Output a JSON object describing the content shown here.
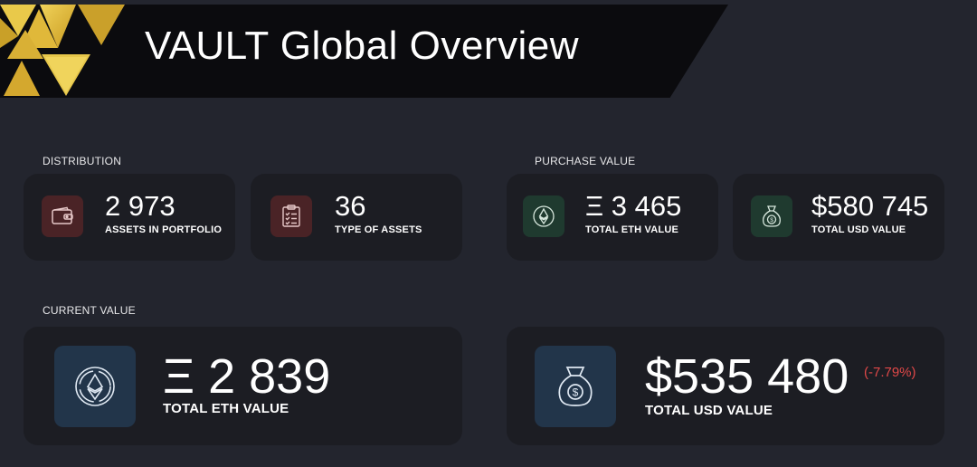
{
  "header": {
    "title": "VAULT Global Overview"
  },
  "colors": {
    "gold": "#e8c23a",
    "negative": "#e04848"
  },
  "distribution": {
    "label": "DISTRIBUTION",
    "assets": {
      "value": "2 973",
      "label": "ASSETS IN PORTFOLIO",
      "icon": "wallet-icon"
    },
    "types": {
      "value": "36",
      "label": "TYPE OF ASSETS",
      "icon": "checklist-icon"
    }
  },
  "purchase": {
    "label": "PURCHASE VALUE",
    "eth": {
      "value": "Ξ 3 465",
      "label": "TOTAL ETH VALUE",
      "icon": "ethereum-icon"
    },
    "usd": {
      "value": "$580 745",
      "label": "TOTAL USD VALUE",
      "icon": "money-bag-icon"
    }
  },
  "current": {
    "label": "CURRENT VALUE",
    "eth": {
      "value": "Ξ 2 839",
      "label": "TOTAL ETH VALUE",
      "icon": "ethereum-icon"
    },
    "usd": {
      "value": "$535 480",
      "label": "TOTAL USD VALUE",
      "change": "(-7.79%)",
      "icon": "money-bag-icon"
    }
  }
}
